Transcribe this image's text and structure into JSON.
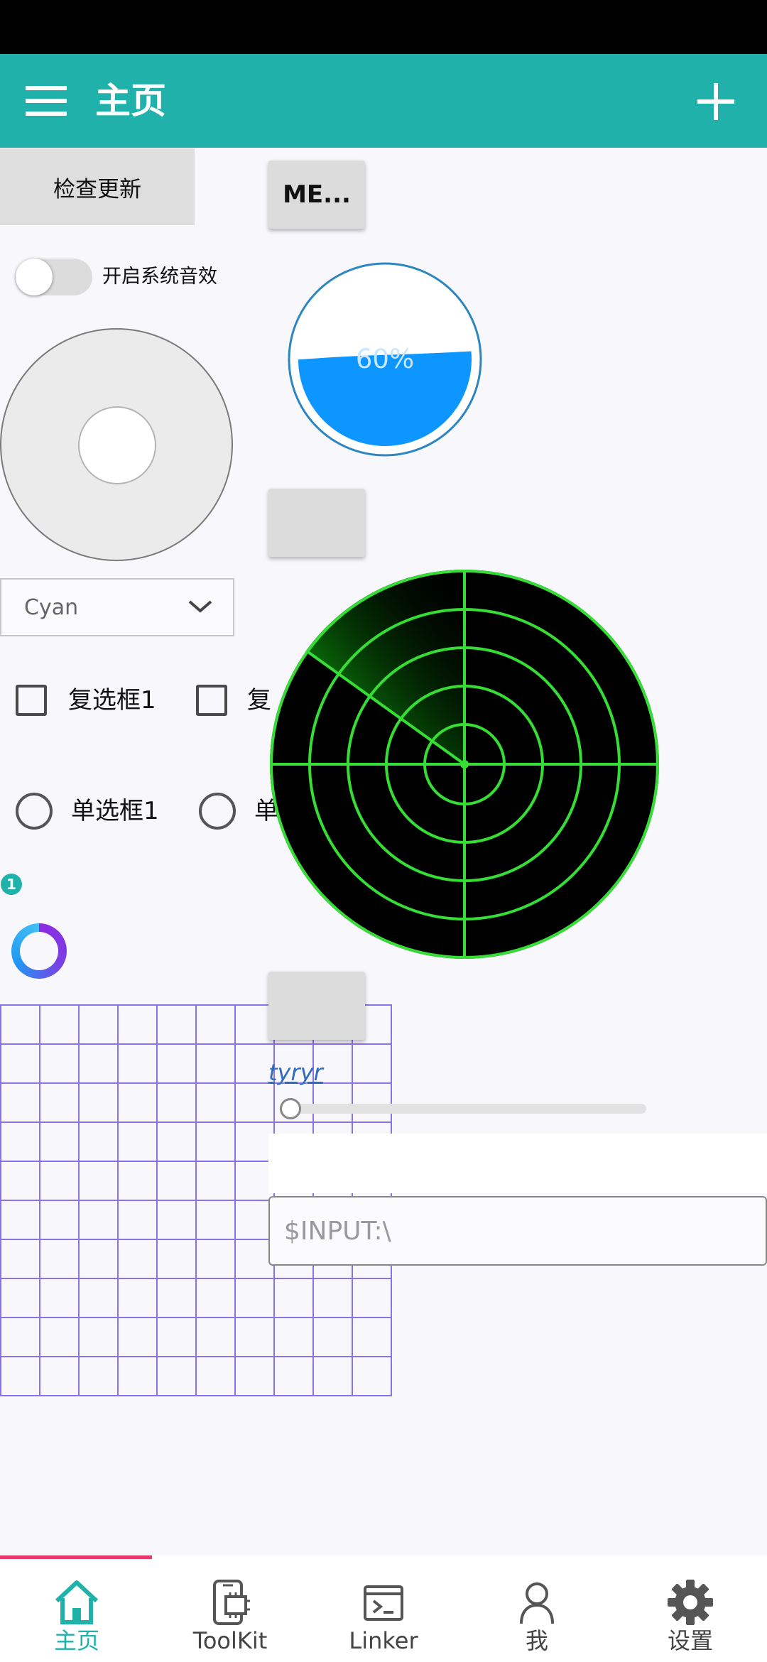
{
  "header": {
    "title": "主页",
    "accent_color": "#20b2aa",
    "menu_icon": "hamburger-menu-icon",
    "add_icon": "plus-icon"
  },
  "controls": {
    "check_update_label": "检查更新",
    "sound_toggle_label": "开启系统音效",
    "sound_toggle_on": false,
    "color_select_value": "Cyan",
    "checkbox_1_label": "复选框1",
    "checkbox_2_label": "复",
    "radio_1_label": "单选框1",
    "radio_2_label": "单",
    "badge_count": "1"
  },
  "right": {
    "menu_button_label": "ME...",
    "progress_percent": 60,
    "progress_label": "60%",
    "link_text": "tyryr",
    "slider_value": 0,
    "input_placeholder": "$INPUT:\\"
  },
  "radar": {
    "ring_color": "#33dd33",
    "background": "#000000"
  },
  "nav": {
    "items": [
      {
        "label": "主页",
        "icon": "home-icon",
        "active": true
      },
      {
        "label": "ToolKit",
        "icon": "phone-chip-icon",
        "active": false
      },
      {
        "label": "Linker",
        "icon": "terminal-icon",
        "active": false
      },
      {
        "label": "我",
        "icon": "person-icon",
        "active": false
      },
      {
        "label": "设置",
        "icon": "gear-icon",
        "active": false
      }
    ]
  }
}
